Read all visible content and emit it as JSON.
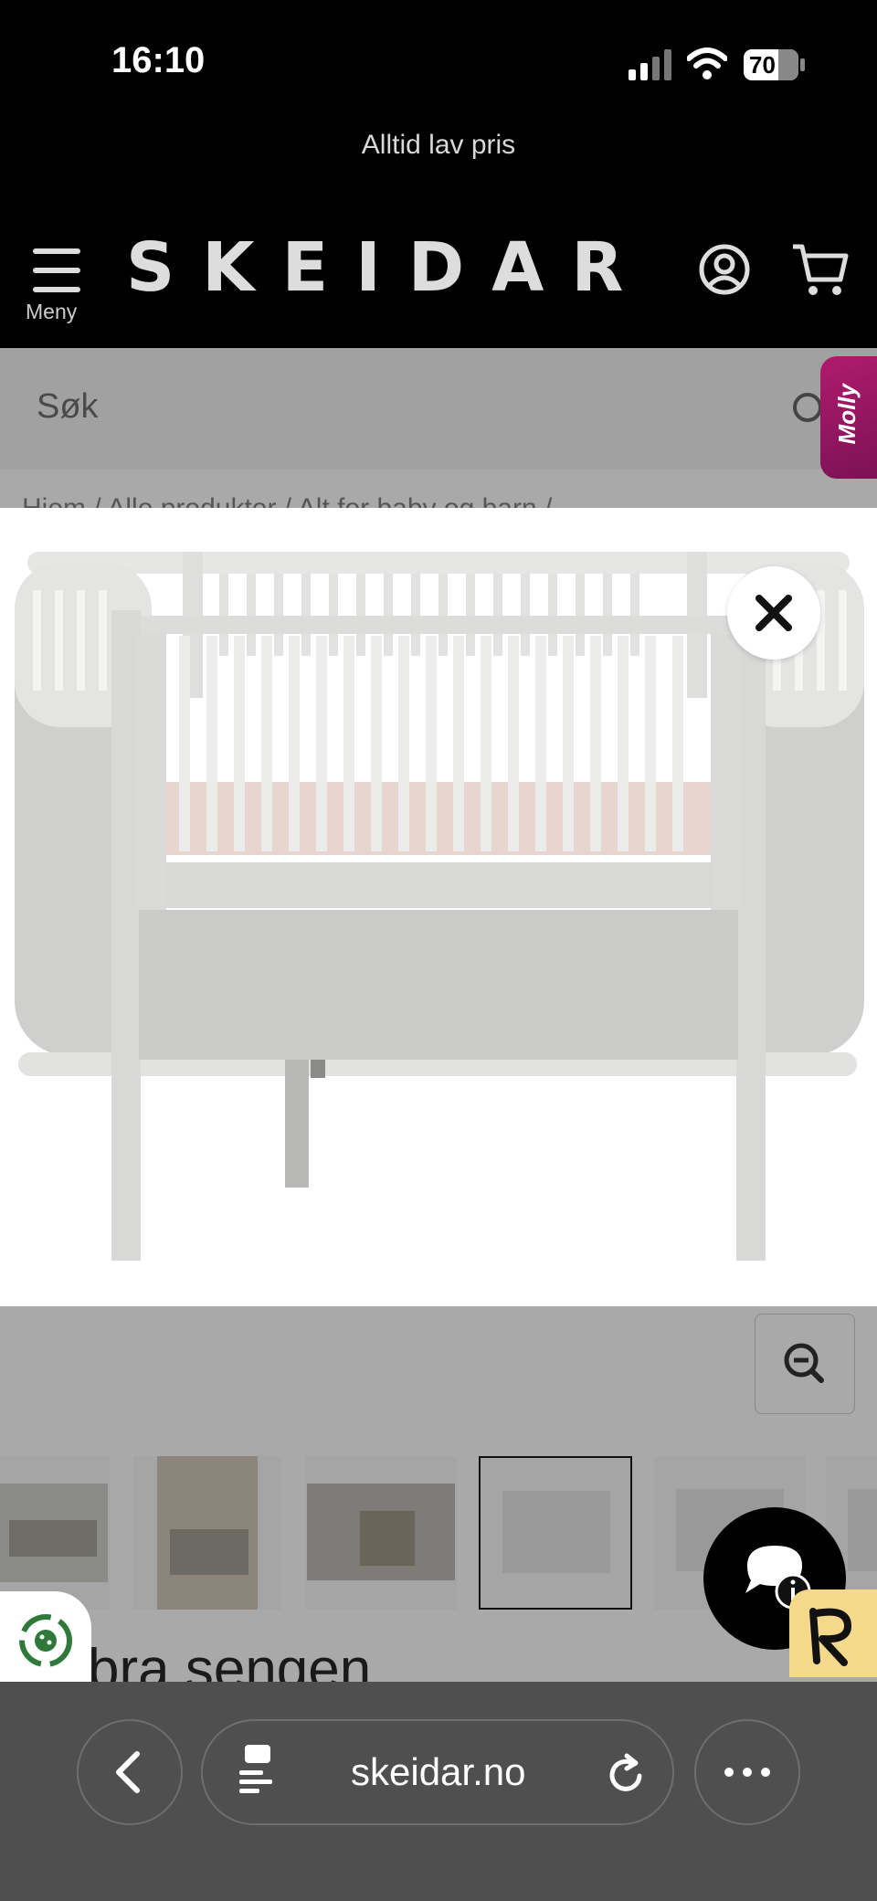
{
  "status_bar": {
    "time": "16:10",
    "battery": "70"
  },
  "header": {
    "promo": "Alltid lav pris",
    "logo": "SKEIDAR",
    "menu_label": "Meny"
  },
  "search": {
    "placeholder": "Søk"
  },
  "molly": {
    "label": "Molly"
  },
  "breadcrumb": "Hjem / Alle produkter / Alt for baby og barn / ...",
  "product": {
    "title_partial": "bra sengen"
  },
  "thumbnails": {
    "count": 6,
    "selected_index": 3
  },
  "browser": {
    "url": "skeidar.no"
  },
  "colors": {
    "header_bg": "#000000",
    "overlay_grey": "#a9a9a9",
    "browser_bar": "#4f4f4f",
    "molly_accent": "#b01b6d",
    "badge": "#f5d98a"
  }
}
